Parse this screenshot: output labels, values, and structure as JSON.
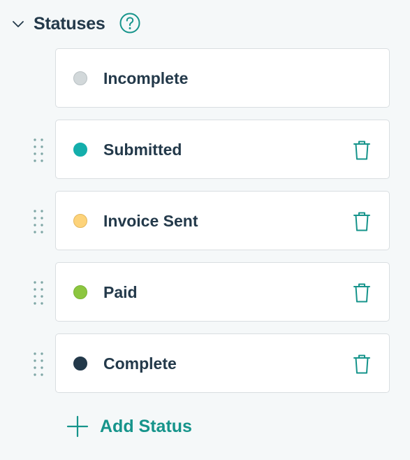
{
  "section": {
    "title": "Statuses",
    "collapse_icon": "chevron-down-icon",
    "help_icon": "question-circle-icon"
  },
  "statuses": [
    {
      "label": "Incomplete",
      "color": "#d2d8da",
      "border": "#b9c1c4",
      "deletable": false,
      "draggable": false
    },
    {
      "label": "Submitted",
      "color": "#14aeab",
      "border": "#14aeab",
      "deletable": true,
      "draggable": true
    },
    {
      "label": "Invoice Sent",
      "color": "#fdd37a",
      "border": "#e3b85f",
      "deletable": true,
      "draggable": true
    },
    {
      "label": "Paid",
      "color": "#8cc63f",
      "border": "#7ab335",
      "deletable": true,
      "draggable": true
    },
    {
      "label": "Complete",
      "color": "#23394a",
      "border": "#23394a",
      "deletable": true,
      "draggable": true
    }
  ],
  "add_button": {
    "label": "Add Status",
    "icon": "plus-icon"
  },
  "colors": {
    "accent": "#16948b",
    "text": "#23394a",
    "background": "#f5f8f9",
    "card": "#ffffff",
    "border": "#d9dee1"
  }
}
